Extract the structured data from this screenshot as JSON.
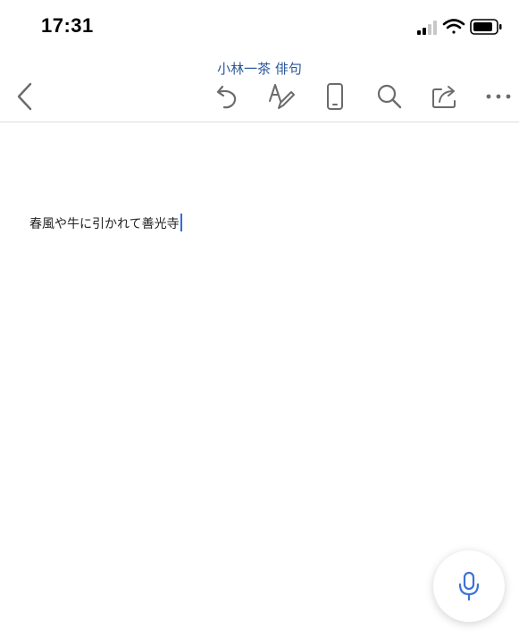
{
  "status_bar": {
    "time": "17:31",
    "icons": [
      "signal-icon",
      "wifi-icon",
      "battery-icon"
    ]
  },
  "document": {
    "title": "小林一茶 俳句",
    "body_text": "春風や牛に引かれて善光寺"
  },
  "toolbar": {
    "icons": [
      "back-icon",
      "undo-icon",
      "text-format-icon",
      "mobile-view-icon",
      "search-icon",
      "share-icon",
      "more-icon"
    ]
  },
  "fab": {
    "icon": "microphone-icon"
  },
  "colors": {
    "accent": "#2b579a",
    "icon": "#6b6b6b",
    "caret": "#2b6cdf",
    "mic": "#3a73d6"
  }
}
